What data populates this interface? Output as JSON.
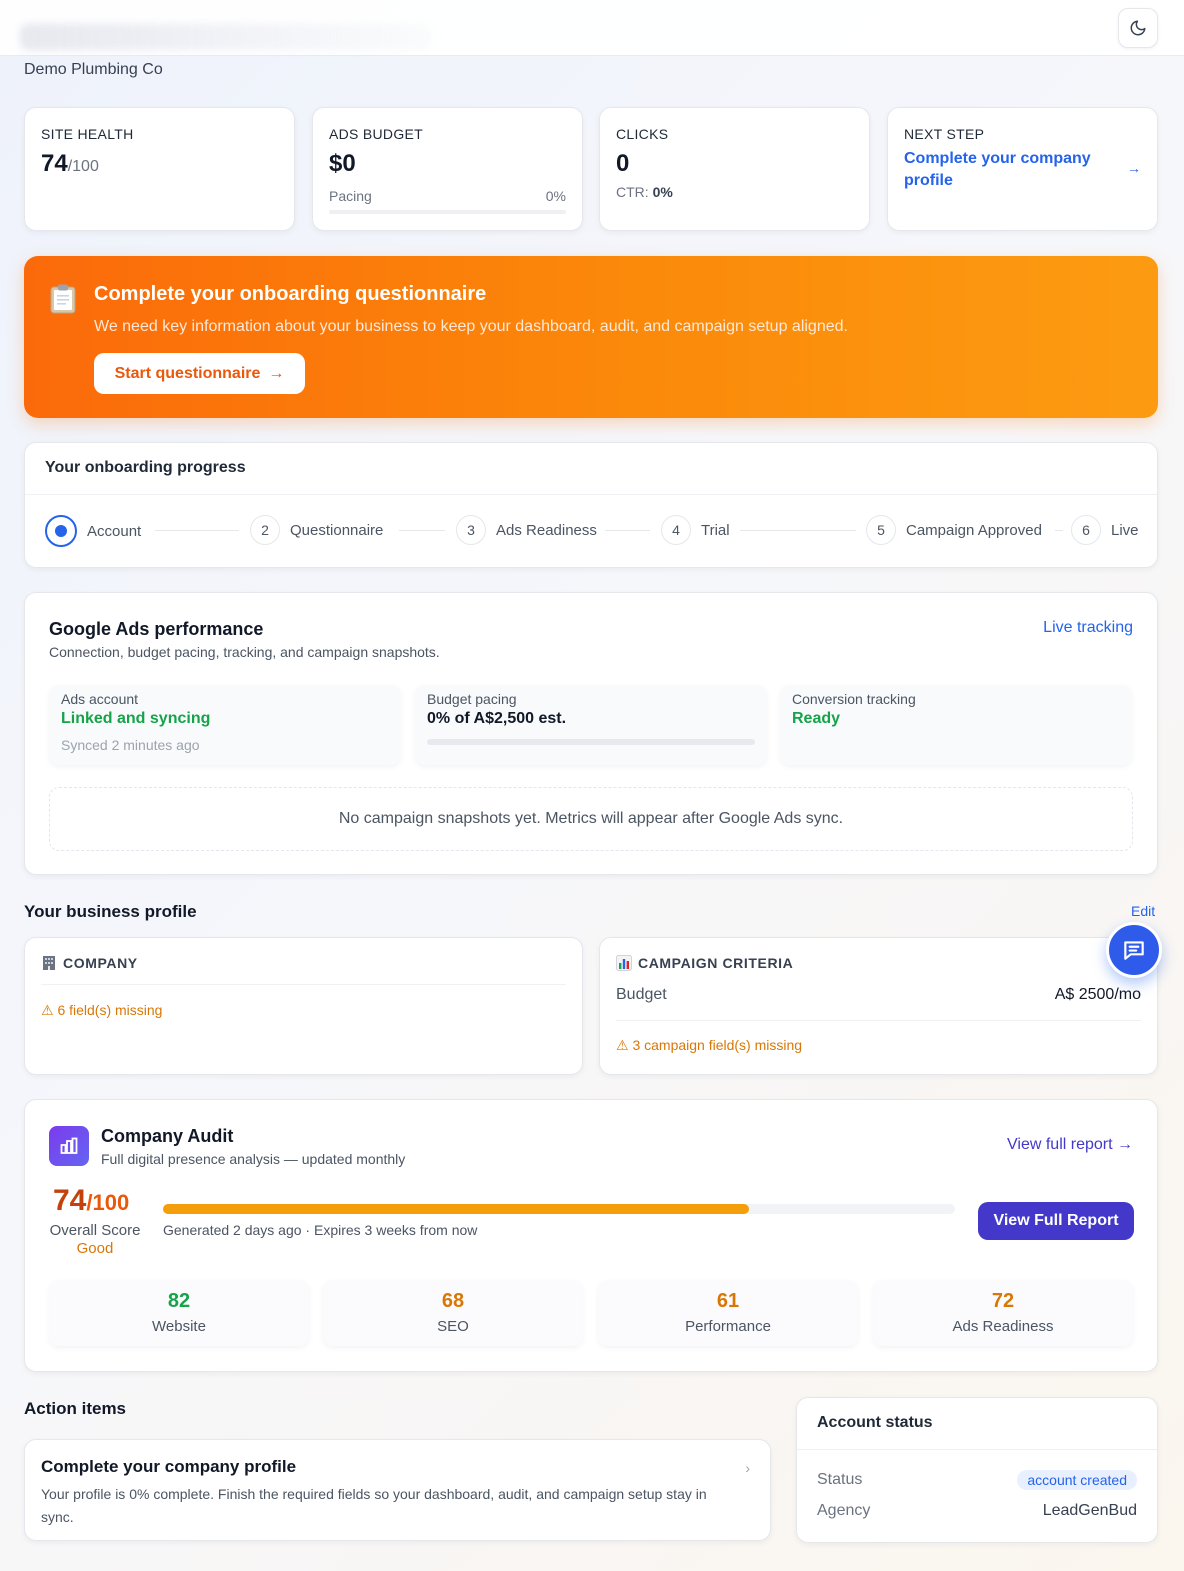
{
  "header": {
    "theme_toggle_icon": "moon-icon",
    "company_name": "Demo Plumbing Co"
  },
  "stats": {
    "site_health": {
      "label": "SITE HEALTH",
      "value": "74",
      "suffix": "/100"
    },
    "ads_budget": {
      "label": "ADS BUDGET",
      "value": "$0",
      "pacing_label": "Pacing",
      "pacing_value": "0%",
      "pacing_fraction": 0
    },
    "clicks": {
      "label": "CLICKS",
      "value": "0",
      "ctr_label": "CTR:",
      "ctr_value": "0%"
    },
    "next_step": {
      "label": "NEXT STEP",
      "link": "Complete your company profile",
      "arrow": "→"
    }
  },
  "banner": {
    "icon": "clipboard-icon",
    "title": "Complete your onboarding questionnaire",
    "subtitle": "We need key information about your business to keep your dashboard, audit, and campaign setup aligned.",
    "button": "Start questionnaire",
    "button_arrow": "→",
    "colors": {
      "start": "#fb6a0a",
      "end": "#fc9b12"
    }
  },
  "onboarding": {
    "title": "Your onboarding progress",
    "active_step": 1,
    "steps": [
      {
        "num": "1",
        "label": "Account"
      },
      {
        "num": "2",
        "label": "Questionnaire"
      },
      {
        "num": "3",
        "label": "Ads Readiness"
      },
      {
        "num": "4",
        "label": "Trial"
      },
      {
        "num": "5",
        "label": "Campaign Approved"
      },
      {
        "num": "6",
        "label": "Live"
      }
    ]
  },
  "google_ads": {
    "title": "Google Ads performance",
    "subtitle": "Connection, budget pacing, tracking, and campaign snapshots.",
    "live_link": "Live tracking",
    "ads_account": {
      "label": "Ads account",
      "value": "Linked and syncing",
      "foot": "Synced 2 minutes ago"
    },
    "budget_pacing": {
      "label": "Budget pacing",
      "value": "0% of A$2,500 est.",
      "fraction": 0
    },
    "conversion": {
      "label": "Conversion tracking",
      "value": "Ready"
    },
    "empty": "No campaign snapshots yet. Metrics will appear after Google Ads sync."
  },
  "business_profile": {
    "title": "Your business profile",
    "edit": "Edit",
    "company": {
      "icon": "building-icon",
      "heading": "COMPANY",
      "warning": "⚠ 6 field(s) missing"
    },
    "campaign": {
      "icon": "bar-chart-icon",
      "heading": "CAMPAIGN CRITERIA",
      "budget_label": "Budget",
      "budget_value": "A$ 2500/mo",
      "warning": "⚠ 3 campaign field(s) missing"
    }
  },
  "chat_icon": "chat-icon",
  "audit": {
    "icon": "bar-chart-icon",
    "title": "Company Audit",
    "subtitle": "Full digital presence analysis — updated monthly",
    "link": "View full report →",
    "score": "74",
    "score_suffix": "/100",
    "score_fraction": 0.74,
    "overall_label": "Overall Score",
    "grade": "Good",
    "generated": "Generated 2 days ago · Expires 3 weeks from now",
    "button": "View Full Report",
    "sub_scores": [
      {
        "value": "82",
        "label": "Website",
        "color": "#16a34a"
      },
      {
        "value": "68",
        "label": "SEO",
        "color": "#d97706"
      },
      {
        "value": "61",
        "label": "Performance",
        "color": "#d97706"
      },
      {
        "value": "72",
        "label": "Ads Readiness",
        "color": "#d97706"
      }
    ]
  },
  "action_items": {
    "title": "Action items",
    "items": [
      {
        "title": "Complete your company profile",
        "desc": "Your profile is 0% complete. Finish the required fields so your dashboard, audit, and campaign setup stay in sync.",
        "chevron": "›"
      }
    ]
  },
  "account_status": {
    "title": "Account status",
    "status_label": "Status",
    "status_value": "account created",
    "agency_label": "Agency",
    "agency_value": "LeadGenBud"
  }
}
